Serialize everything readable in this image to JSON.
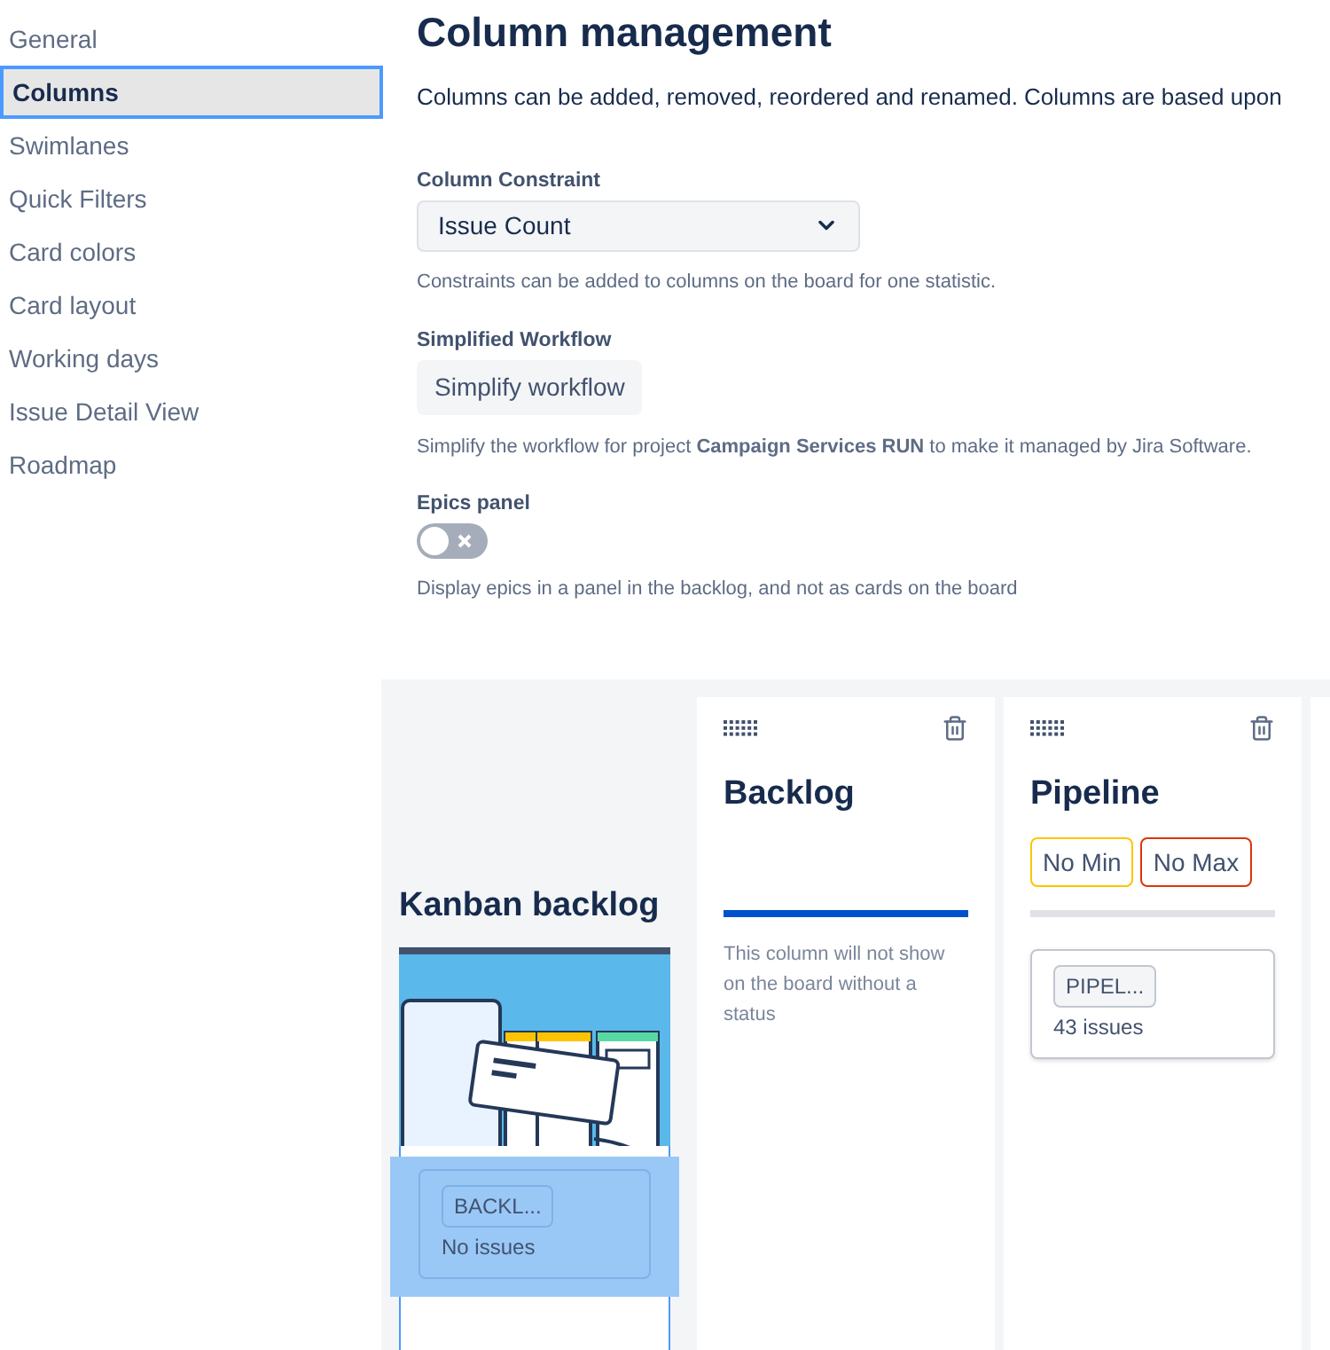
{
  "sidebar": {
    "items": [
      {
        "label": "General",
        "selected": false
      },
      {
        "label": "Columns",
        "selected": true
      },
      {
        "label": "Swimlanes",
        "selected": false
      },
      {
        "label": "Quick Filters",
        "selected": false
      },
      {
        "label": "Card colors",
        "selected": false
      },
      {
        "label": "Card layout",
        "selected": false
      },
      {
        "label": "Working days",
        "selected": false
      },
      {
        "label": "Issue Detail View",
        "selected": false
      },
      {
        "label": "Roadmap",
        "selected": false
      }
    ]
  },
  "main": {
    "title": "Column management",
    "intro": "Columns can be added, removed, reordered and renamed. Columns are based upon",
    "constraint": {
      "label": "Column Constraint",
      "value": "Issue Count",
      "help": "Constraints can be added to columns on the board for one statistic."
    },
    "workflow": {
      "label": "Simplified Workflow",
      "button": "Simplify workflow",
      "help": "Simplify the workflow for project **Campaign Services RUN** to make it managed by Jira Software."
    },
    "epics": {
      "label": "Epics panel",
      "on": false,
      "help": "Display epics in a panel in the backlog, and not as cards on the board"
    }
  },
  "board": {
    "backlog": {
      "title": "Kanban backlog",
      "status": {
        "name": "BACKL...",
        "count": "No issues",
        "selected": true
      }
    },
    "columns": [
      {
        "title": "Backlog",
        "color": "#0052cc",
        "note": "This column will not show on the board without a status"
      },
      {
        "title": "Pipeline",
        "color": "#dfe1e6",
        "min": "No Min",
        "max": "No Max",
        "status": {
          "name": "PIPEL...",
          "count": "43 issues"
        }
      }
    ]
  }
}
